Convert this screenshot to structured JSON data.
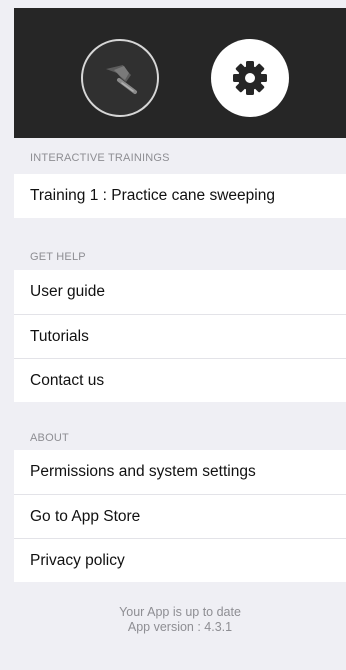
{
  "header": {
    "buttons": [
      {
        "icon": "cane-icon"
      },
      {
        "icon": "gear-icon"
      }
    ]
  },
  "sections": {
    "interactive_trainings": {
      "title": "INTERACTIVE TRAININGS",
      "items": [
        "Training 1 : Practice cane sweeping"
      ]
    },
    "get_help": {
      "title": "GET HELP",
      "items": [
        "User guide",
        "Tutorials",
        "Contact us"
      ]
    },
    "about": {
      "title": "ABOUT",
      "items": [
        "Permissions and system settings",
        "Go to App Store",
        "Privacy policy"
      ]
    }
  },
  "footer": {
    "status": "Your App is up to date",
    "version": "App version : 4.3.1"
  },
  "colors": {
    "header_bg": "#262626",
    "list_bg": "#efeff4",
    "secondary_text": "#8e8e93"
  }
}
